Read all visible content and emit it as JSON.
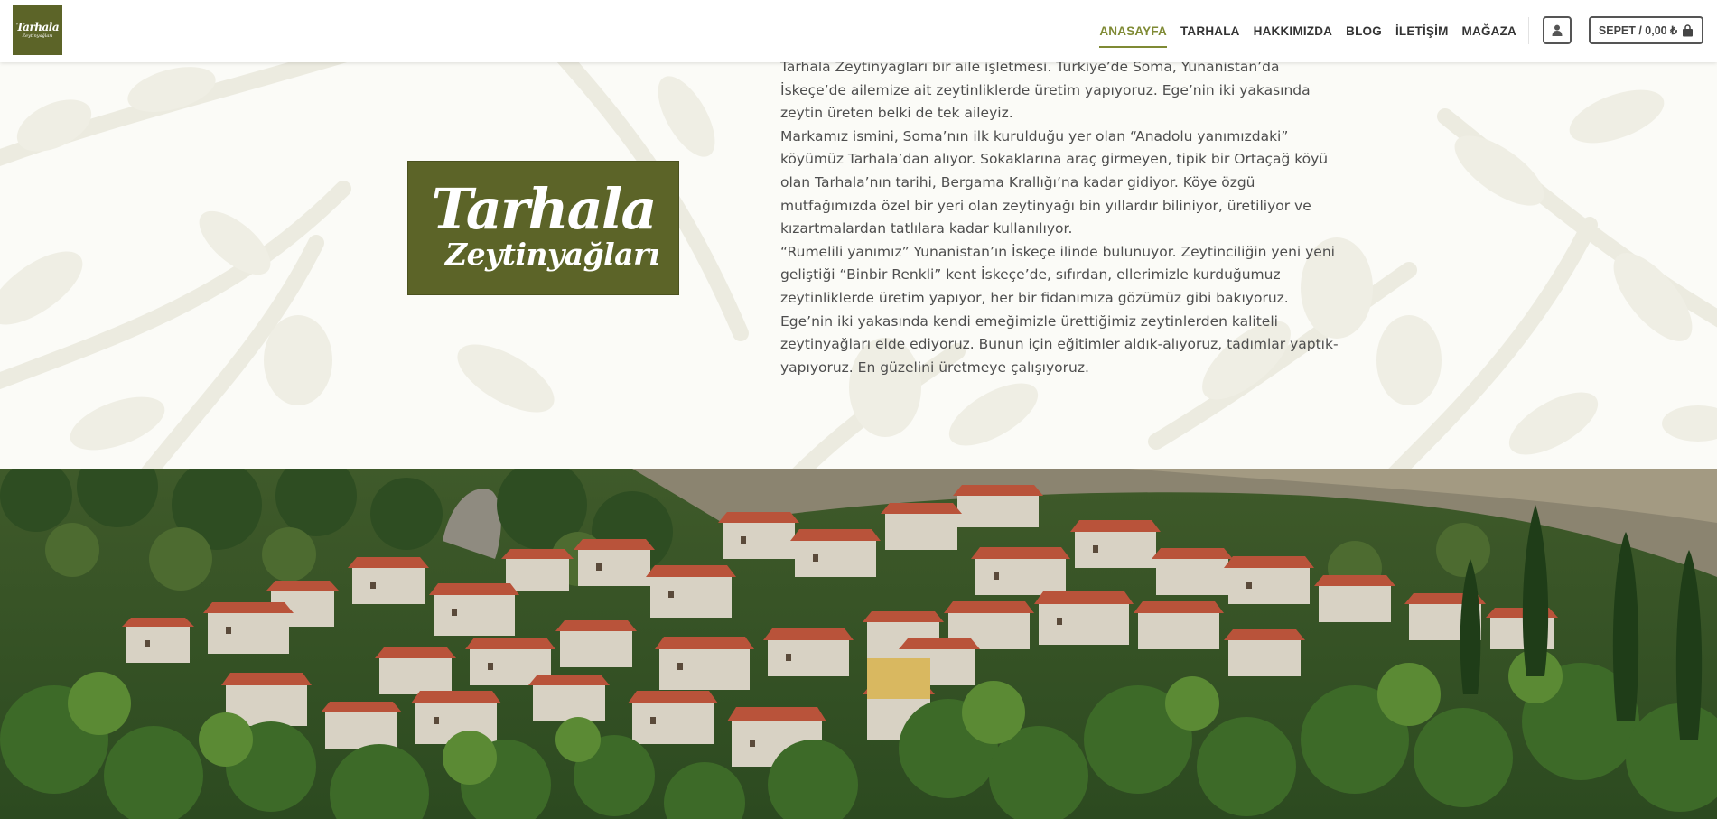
{
  "header": {
    "logo": {
      "line1": "Tarhala",
      "line2": "Zeytinyağları"
    },
    "nav": [
      {
        "label": "ANASAYFA",
        "active": true
      },
      {
        "label": "TARHALA",
        "active": false
      },
      {
        "label": "HAKKIMIZDA",
        "active": false
      },
      {
        "label": "BLOG",
        "active": false
      },
      {
        "label": "İLETİŞİM",
        "active": false
      },
      {
        "label": "MAĞAZA",
        "active": false
      }
    ],
    "account_icon": "user-icon",
    "cart": {
      "label": "SEPET / 0,00 ₺",
      "icon": "shopping-bag-icon"
    }
  },
  "intro": {
    "logo": {
      "line1": "Tarhala",
      "line2": "Zeytinyağları"
    },
    "paragraphs": [
      "Tarhala Zeytinyağları bir aile işletmesi. Türkiye’de Soma, Yunanistan’da İskeçe’de ailemize ait zeytinliklerde üretim yapıyoruz. Ege’nin iki yakasında zeytin üreten belki de tek aileyiz.",
      "Markamız ismini, Soma’nın ilk kurulduğu yer olan “Anadolu yanımızdaki” köyümüz Tarhala’dan alıyor. Sokaklarına araç girmeyen, tipik bir Ortaçağ köyü olan Tarhala’nın tarihi, Bergama Krallığı’na kadar gidiyor. Köye özgü mutfağımızda özel bir yeri olan zeytinyağı bin yıllardır biliniyor, üretiliyor ve kızartmalardan tatlılara kadar kullanılıyor.",
      "“Rumelili yanımız” Yunanistan’ın İskeçe ilinde bulunuyor. Zeytinciliğin yeni yeni geliştiği “Binbir Renkli” kent İskeçe’de, sıfırdan, ellerimizle kurduğumuz zeytinliklerde üretim yapıyor, her bir fidanımıza gözümüz gibi bakıyoruz.",
      "Ege’nin iki yakasında kendi emeğimizle ürettiğimiz zeytinlerden kaliteli zeytinyağları elde ediyoruz. Bunun için eğitimler aldık-alıyoruz, tadımlar yaptık-yapıyoruz. En güzelini üretmeye çalışıyoruz."
    ]
  },
  "colors": {
    "brand_olive": "#5c6428",
    "nav_active": "#7f8a34",
    "text": "#4e4e4e"
  }
}
